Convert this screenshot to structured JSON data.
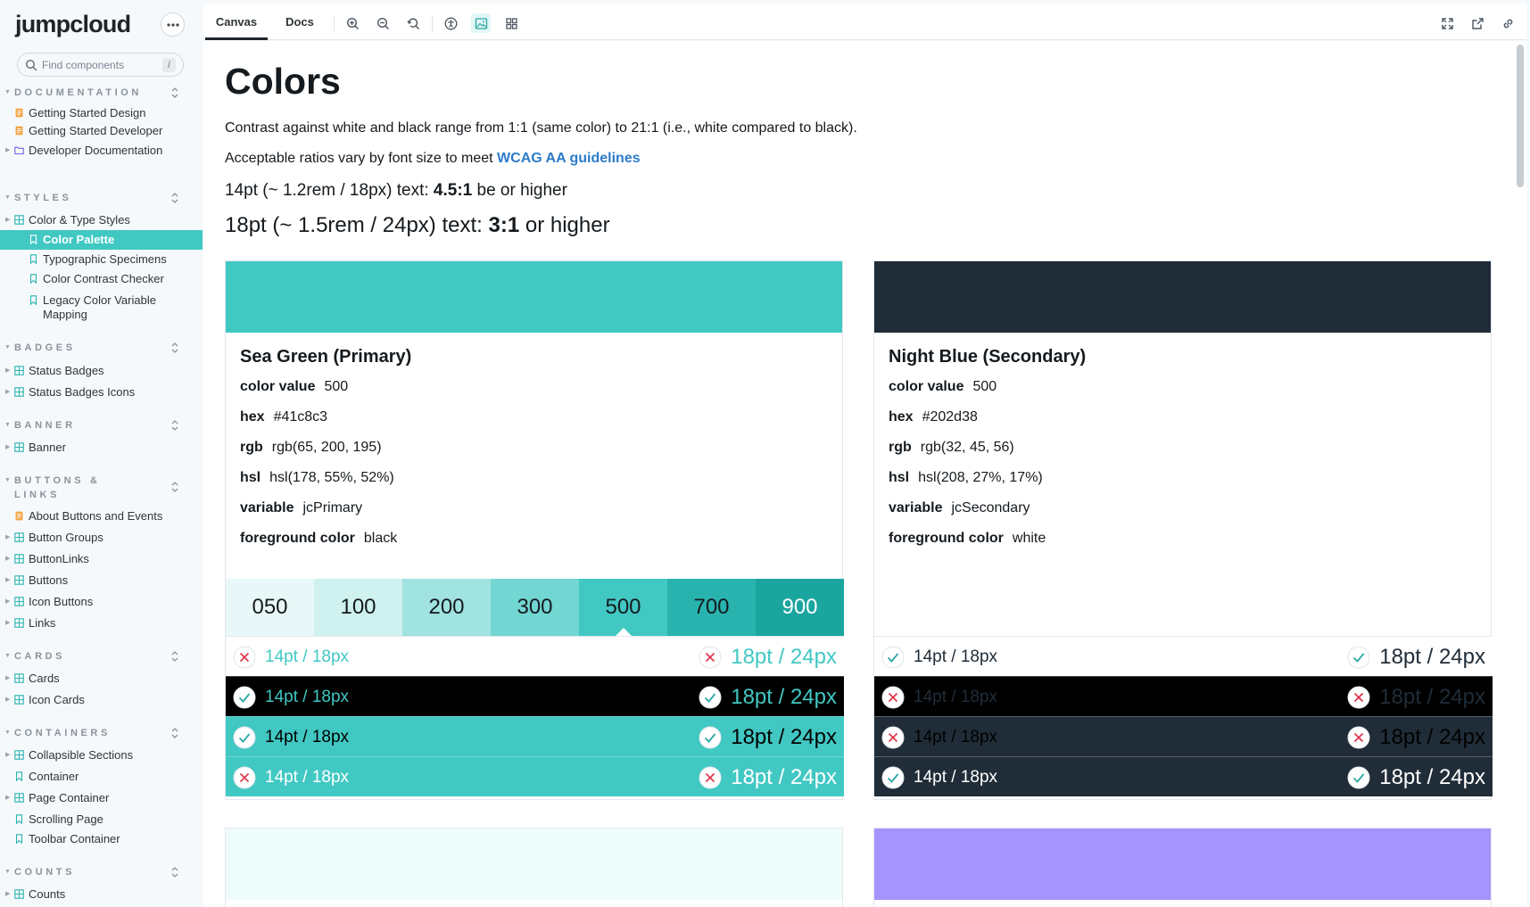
{
  "brand": "jumpcloud",
  "search": {
    "placeholder": "Find components",
    "shortcut": "/"
  },
  "sidebar": {
    "documentation": {
      "title": "DOCUMENTATION",
      "items": [
        "Getting Started Design",
        "Getting Started Developer",
        "Developer Documentation"
      ]
    },
    "styles": {
      "title": "STYLES",
      "group": "Color & Type Styles",
      "items": [
        "Color Palette",
        "Typographic Specimens",
        "Color Contrast Checker",
        "Legacy Color Variable Mapping"
      ]
    },
    "badges": {
      "title": "BADGES",
      "items": [
        "Status Badges",
        "Status Badges Icons"
      ]
    },
    "banner": {
      "title": "BANNER",
      "items": [
        "Banner"
      ]
    },
    "buttons": {
      "title": "BUTTONS & LINKS",
      "items": [
        "About Buttons and Events",
        "Button Groups",
        "ButtonLinks",
        "Buttons",
        "Icon Buttons",
        "Links"
      ]
    },
    "cards": {
      "title": "CARDS",
      "items": [
        "Cards",
        "Icon Cards"
      ]
    },
    "containers": {
      "title": "CONTAINERS",
      "items": [
        "Collapsible Sections",
        "Container",
        "Page Container",
        "Scrolling Page",
        "Toolbar Container"
      ]
    },
    "counts": {
      "title": "COUNTS",
      "items": [
        "Counts"
      ]
    }
  },
  "toolbar": {
    "tabs": [
      "Canvas",
      "Docs"
    ],
    "active_tab": "Canvas"
  },
  "page": {
    "title": "Colors",
    "intro": "Contrast against white and black range from 1:1 (same color) to 21:1 (i.e., white compared to black).",
    "ratios_prefix": "Acceptable ratios vary by font size to meet ",
    "ratios_link": "WCAG AA guidelines",
    "small_prefix": "14pt (~ 1.2rem / 18px) text: ",
    "small_ratio": "4.5:1",
    "small_suffix": " be or higher",
    "large_prefix": "18pt (~ 1.5rem / 24px) text: ",
    "large_ratio": "3:1",
    "large_suffix": " or higher"
  },
  "prop_labels": {
    "value": "color value",
    "hex": "hex",
    "rgb": "rgb",
    "hsl": "hsl",
    "variable": "variable",
    "foreground": "foreground color"
  },
  "sample_labels": {
    "small": "14pt / 18px",
    "large": "18pt / 24px"
  },
  "cards": [
    {
      "name": "Sea Green (Primary)",
      "swatch": "#41c8c3",
      "color_value": "500",
      "hex": "#41c8c3",
      "rgb": "rgb(65, 200, 195)",
      "hsl": "hsl(178, 55%, 52%)",
      "variable": "jcPrimary",
      "foreground": "black",
      "shades": [
        {
          "label": "050",
          "color": "#e8f8f8"
        },
        {
          "label": "100",
          "color": "#cff1f0"
        },
        {
          "label": "200",
          "color": "#a0e3e0"
        },
        {
          "label": "300",
          "color": "#72d6d2"
        },
        {
          "label": "500",
          "color": "#41c8c3"
        },
        {
          "label": "700",
          "color": "#29b3ae"
        },
        {
          "label": "900",
          "color": "#1ba59f"
        }
      ],
      "selected_shade": "500",
      "rows": [
        {
          "bg": "#ffffff",
          "fg": "#41c8c3",
          "small_pass": false,
          "large_pass": false
        },
        {
          "bg": "#000000",
          "fg": "#41c8c3",
          "small_pass": true,
          "large_pass": true
        },
        {
          "bg": "#41c8c3",
          "fg": "#000000",
          "small_pass": true,
          "large_pass": true
        },
        {
          "bg": "#41c8c3",
          "fg": "#ffffff",
          "small_pass": false,
          "large_pass": false
        }
      ]
    },
    {
      "name": "Night Blue (Secondary)",
      "swatch": "#202d38",
      "color_value": "500",
      "hex": "#202d38",
      "rgb": "rgb(32, 45, 56)",
      "hsl": "hsl(208, 27%, 17%)",
      "variable": "jcSecondary",
      "foreground": "white",
      "rows": [
        {
          "bg": "#ffffff",
          "fg": "#202d38",
          "small_pass": true,
          "large_pass": true
        },
        {
          "bg": "#000000",
          "fg": "#202d38",
          "small_pass": false,
          "large_pass": false
        },
        {
          "bg": "#202d38",
          "fg": "#000000",
          "small_pass": false,
          "large_pass": false
        },
        {
          "bg": "#202d38",
          "fg": "#ffffff",
          "small_pass": true,
          "large_pass": true
        }
      ]
    }
  ],
  "next_swatches": [
    "#effcfc",
    "#a594fc"
  ]
}
